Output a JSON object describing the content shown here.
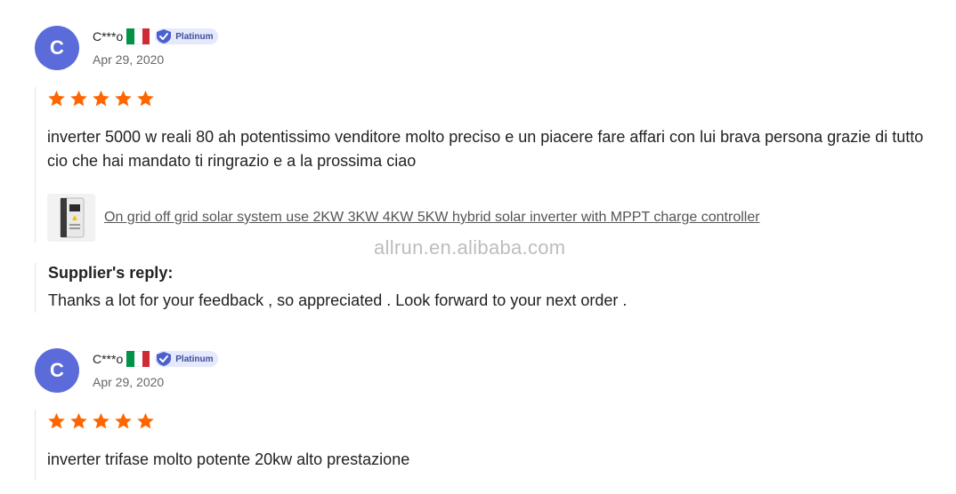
{
  "reviews": [
    {
      "avatar_letter": "C",
      "username": "C***o",
      "country_flag": "italy-flag",
      "badge_label": "Platinum",
      "date": "Apr 29, 2020",
      "rating": 5,
      "text": "inverter 5000 w reali 80 ah potentissimo venditore molto preciso e un piacere fare affari con lui brava persona grazie di tutto cio che hai mandato ti ringrazio e a la prossima ciao",
      "product_link": "On grid off grid solar system use 2KW 3KW 4KW 5KW hybrid solar inverter with MPPT charge controller",
      "supplier_reply_title": "Supplier's reply:",
      "supplier_reply": "Thanks a lot for your feedback , so appreciated . Look forward to your next order ."
    },
    {
      "avatar_letter": "C",
      "username": "C***o",
      "country_flag": "italy-flag",
      "badge_label": "Platinum",
      "date": "Apr 29, 2020",
      "rating": 5,
      "text": "inverter trifase molto potente 20kw alto prestazione"
    }
  ],
  "watermark": "allrun.en.alibaba.com",
  "colors": {
    "avatar": "#5b6bd9",
    "star": "#ff6600",
    "badge_bg": "#e6e9fb",
    "badge_text": "#3c4f9c",
    "flag_green": "#009246",
    "flag_white": "#ffffff",
    "flag_red": "#ce2b37"
  }
}
